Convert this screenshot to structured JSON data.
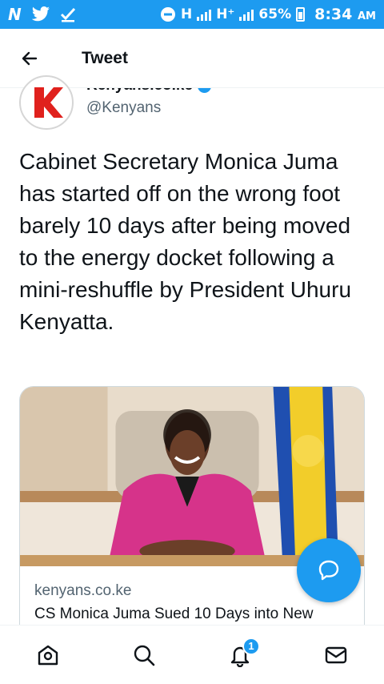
{
  "status_bar": {
    "left_icons": [
      "N",
      "twitter-bird",
      "download-check"
    ],
    "network_1": "H",
    "network_2": "H⁺",
    "battery": "65%",
    "time": "8:34",
    "ampm": "AM"
  },
  "header": {
    "title": "Tweet"
  },
  "tweet": {
    "author_name": "Kenyans.co.ke",
    "handle": "@Kenyans",
    "text": "Cabinet Secretary Monica Juma has started off on the wrong foot barely 10 days after being moved to the energy docket following a mini-reshuffle by President Uhuru Kenyatta."
  },
  "card": {
    "domain": "kenyans.co.ke",
    "title": "CS Monica Juma Sued 10 Days into New"
  },
  "bottom_nav": {
    "items": [
      "home",
      "search",
      "notifications",
      "messages"
    ],
    "notification_count": "1"
  },
  "colors": {
    "accent": "#1d9bf0",
    "text": "#0f1419",
    "secondary": "#536471",
    "brand_red": "#e0211d"
  }
}
